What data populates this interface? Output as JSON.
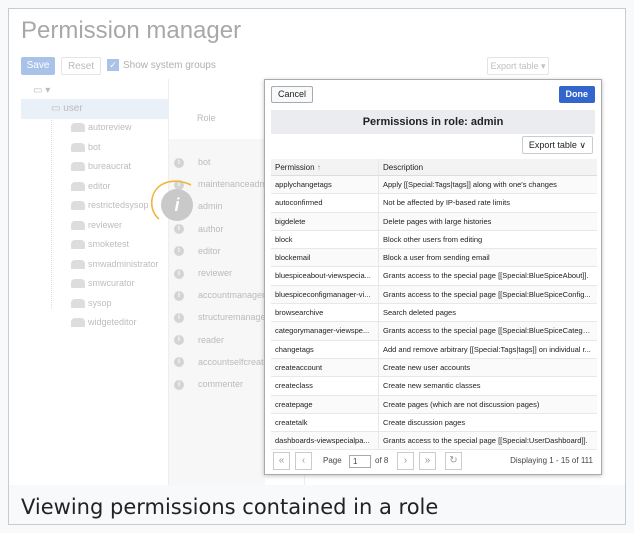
{
  "page": {
    "title": "Permission manager",
    "caption": "Viewing permissions contained in a role"
  },
  "toolbar": {
    "save": "Save",
    "reset": "Reset",
    "show_system_groups": "Show system groups",
    "export_table": "Export table"
  },
  "tree": {
    "user": "user",
    "groups": [
      "autoreview",
      "bot",
      "bureaucrat",
      "editor",
      "restrictedsysop",
      "reviewer",
      "smoketest",
      "smwadministrator",
      "smwcurator",
      "sysop",
      "widgeteditor"
    ]
  },
  "roles": {
    "header": "Role",
    "items": [
      "bot",
      "maintenanceadmin",
      "admin",
      "author",
      "editor",
      "reviewer",
      "accountmanager",
      "structuremanager",
      "reader",
      "accountselfcreate",
      "commenter"
    ]
  },
  "dialog": {
    "cancel": "Cancel",
    "done": "Done",
    "title": "Permissions in role: admin",
    "export": "Export table",
    "col_permission": "Permission",
    "col_description": "Description",
    "rows": [
      {
        "p": "applychangetags",
        "d": "Apply [[Special:Tags|tags]] along with one's changes"
      },
      {
        "p": "autoconfirmed",
        "d": "Not be affected by IP-based rate limits"
      },
      {
        "p": "bigdelete",
        "d": "Delete pages with large histories"
      },
      {
        "p": "block",
        "d": "Block other users from editing"
      },
      {
        "p": "blockemail",
        "d": "Block a user from sending email"
      },
      {
        "p": "bluespiceabout-viewspecia...",
        "d": "Grants access to the special page [[Special:BlueSpiceAbout]]."
      },
      {
        "p": "bluespiceconfigmanager-vi...",
        "d": "Grants access to the special page [[Special:BlueSpiceConfig..."
      },
      {
        "p": "browsearchive",
        "d": "Search deleted pages"
      },
      {
        "p": "categorymanager-viewspe...",
        "d": "Grants access to the special page [[Special:BlueSpiceCatego..."
      },
      {
        "p": "changetags",
        "d": "Add and remove arbitrary [[Special:Tags|tags]] on individual r..."
      },
      {
        "p": "createaccount",
        "d": "Create new user accounts"
      },
      {
        "p": "createclass",
        "d": "Create new semantic classes"
      },
      {
        "p": "createpage",
        "d": "Create pages (which are not discussion pages)"
      },
      {
        "p": "createtalk",
        "d": "Create discussion pages"
      },
      {
        "p": "dashboards-viewspecialpa...",
        "d": "Grants access to the special page [[Special:UserDashboard]]."
      }
    ],
    "pager": {
      "page_label": "Page",
      "page_value": "1",
      "of": "of 8",
      "displaying": "Displaying 1 - 15 of 111"
    }
  },
  "colors": {
    "accent": "#3366cc",
    "highlight": "#f0b53a"
  }
}
